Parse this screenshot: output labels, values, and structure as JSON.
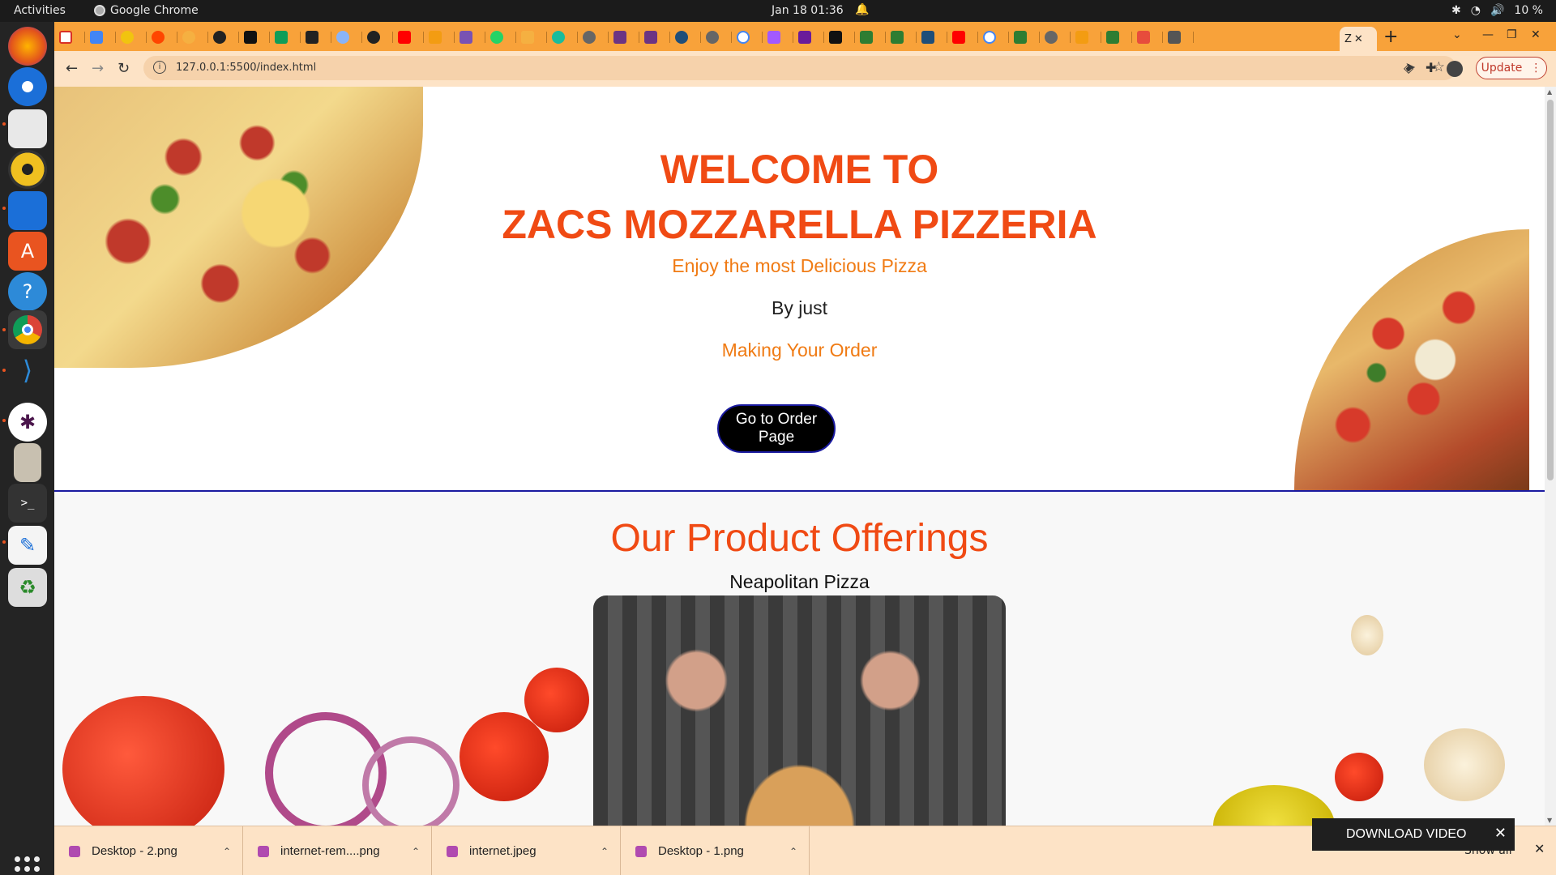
{
  "system": {
    "activities": "Activities",
    "app_name": "Google Chrome",
    "clock": "Jan 18  01:36",
    "battery": "10 %"
  },
  "dock": {
    "items": [
      "firefox-icon",
      "thunderbird-icon",
      "files-icon",
      "rhythmbox-icon",
      "writer-icon",
      "software-icon",
      "help-icon",
      "chrome-icon",
      "vscode-icon",
      "slack-icon",
      "archive-icon",
      "terminal-icon",
      "text-editor-icon",
      "trash-icon"
    ]
  },
  "browser": {
    "active_tab_label": "Z",
    "url": "127.0.0.1:5500/index.html",
    "update_label": "Update"
  },
  "hero": {
    "title_line1": "WELCOME TO",
    "title_line2": "ZACS MOZZARELLA PIZZERIA",
    "tagline": "Enjoy the most Delicious Pizza",
    "by_just": "By just",
    "making_order": "Making Your Order",
    "order_button": "Go to Order Page"
  },
  "products": {
    "heading": "Our Product Offerings",
    "items": [
      {
        "name": "Neapolitan Pizza"
      }
    ]
  },
  "downloads": {
    "items": [
      {
        "name": "Desktop - 2.png"
      },
      {
        "name": "internet-rem....png"
      },
      {
        "name": "internet.jpeg"
      },
      {
        "name": "Desktop - 1.png"
      }
    ],
    "show_all": "Show all",
    "download_video": "DOWNLOAD VIDEO"
  },
  "colors": {
    "accent_red": "#f04a14",
    "accent_orange": "#f07b14",
    "chrome_orange": "#f8a23a",
    "border_blue": "#1a1aa0"
  }
}
